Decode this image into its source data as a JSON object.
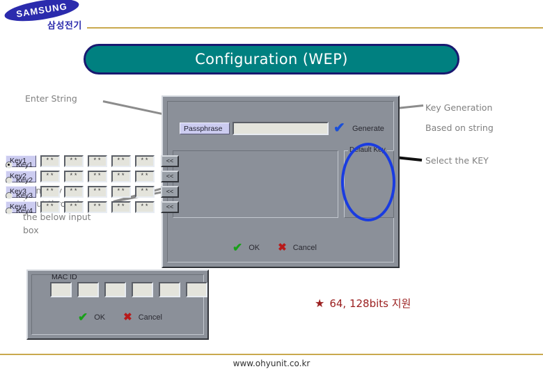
{
  "brand": {
    "wordmark": "SAMSUNG",
    "korean_name": "삼성전기"
  },
  "title": {
    "text": "Configuration (WEP)",
    "fill_color": "#008080",
    "border_color": "#191970",
    "text_color": "#ffffff"
  },
  "annotations": {
    "enter_string": "Enter String",
    "manual_input": "Manually key\ninput through\nthe below input\nbox",
    "key_generation": "Key Generation",
    "based_on_string": "Based on string",
    "select_the_key": "Select the KEY",
    "text_color": "#808080",
    "leader_color": "#8c8c8c"
  },
  "wep_dialog": {
    "passphrase_label": "Passphrase",
    "passphrase_value": "",
    "generate_label": "Generate",
    "generate_check_icon": "blue-check-icon",
    "key_rows": [
      {
        "label": "Key1",
        "cells": [
          "**",
          "**",
          "**",
          "**",
          "**"
        ],
        "shift_button": "<<"
      },
      {
        "label": "Key2",
        "cells": [
          "**",
          "**",
          "**",
          "**",
          "**"
        ],
        "shift_button": "<<"
      },
      {
        "label": "Key3",
        "cells": [
          "**",
          "**",
          "**",
          "**",
          "**"
        ],
        "shift_button": "<<"
      },
      {
        "label": "Key4",
        "cells": [
          "**",
          "**",
          "**",
          "**",
          "**"
        ],
        "shift_button": "<<"
      }
    ],
    "default_key": {
      "legend": "Default Key",
      "options": [
        {
          "label": "Key1",
          "selected": true
        },
        {
          "label": "Key2",
          "selected": false
        },
        {
          "label": "Key3",
          "selected": false
        },
        {
          "label": "Key4",
          "selected": false
        }
      ],
      "highlight_color": "#1a3ce0"
    },
    "ok_label": "OK",
    "cancel_label": "Cancel",
    "ok_icon": "green-check-icon",
    "cancel_icon": "red-x-icon"
  },
  "mac_dialog": {
    "label": "MAC ID",
    "fields": [
      "",
      "",
      "",
      "",
      "",
      ""
    ],
    "ok_label": "OK",
    "cancel_label": "Cancel",
    "ok_icon": "green-check-icon",
    "cancel_icon": "red-x-icon"
  },
  "bottom_note": {
    "star": "★",
    "text": "64, 128bits 지원",
    "color": "#9b2020"
  },
  "footer": {
    "url": "www.ohyunit.co.kr",
    "rule_color": "#c9a94e"
  }
}
